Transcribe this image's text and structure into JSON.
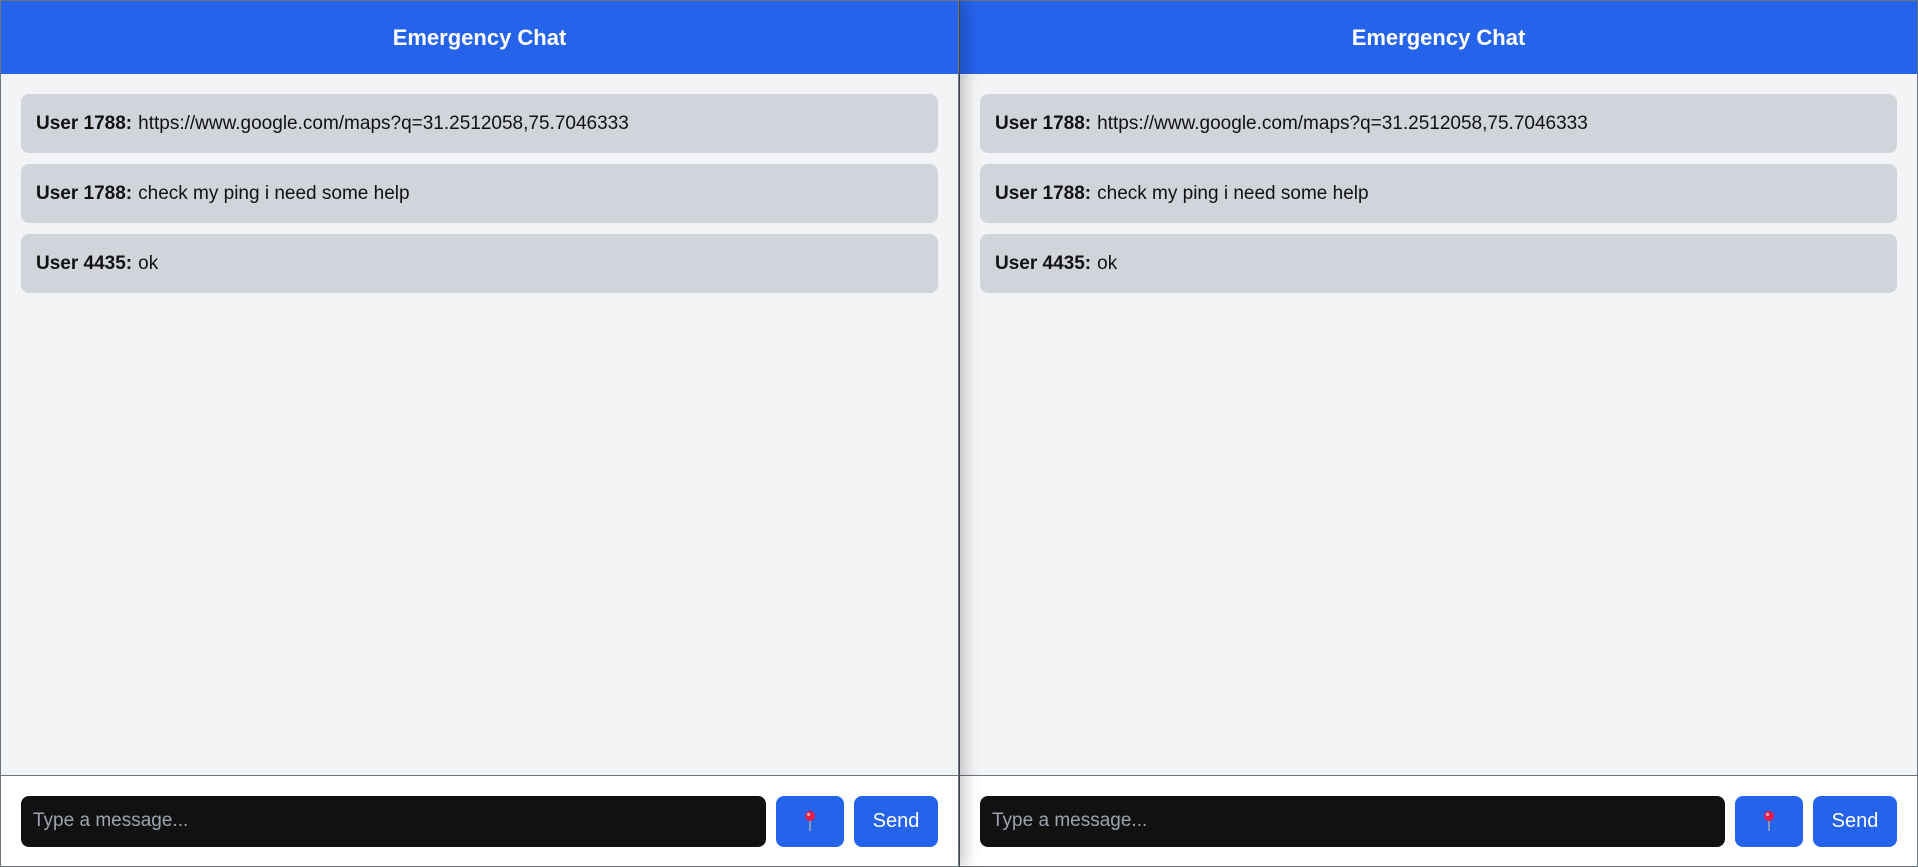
{
  "panels": [
    {
      "header": {
        "title": "Emergency Chat"
      },
      "messages": [
        {
          "sender": "User 1788:",
          "text": "https://www.google.com/maps?q=31.2512058,75.7046333"
        },
        {
          "sender": "User 1788:",
          "text": "check my ping i need some help"
        },
        {
          "sender": "User 4435:",
          "text": "ok"
        }
      ],
      "composer": {
        "input_value": "",
        "placeholder": "Type a message...",
        "location_icon": "pushpin-icon",
        "send_label": "Send"
      }
    },
    {
      "header": {
        "title": "Emergency Chat"
      },
      "messages": [
        {
          "sender": "User 1788:",
          "text": "https://www.google.com/maps?q=31.2512058,75.7046333"
        },
        {
          "sender": "User 1788:",
          "text": "check my ping i need some help"
        },
        {
          "sender": "User 4435:",
          "text": "ok"
        }
      ],
      "composer": {
        "input_value": "",
        "placeholder": "Type a message...",
        "location_icon": "pushpin-icon",
        "send_label": "Send"
      }
    }
  ],
  "colors": {
    "header_bg": "#2563eb",
    "message_bg": "#d1d5db",
    "chat_bg": "#f3f4f6",
    "input_bg": "#111111",
    "button_bg": "#2563eb",
    "pin_head": "#e11d48"
  }
}
